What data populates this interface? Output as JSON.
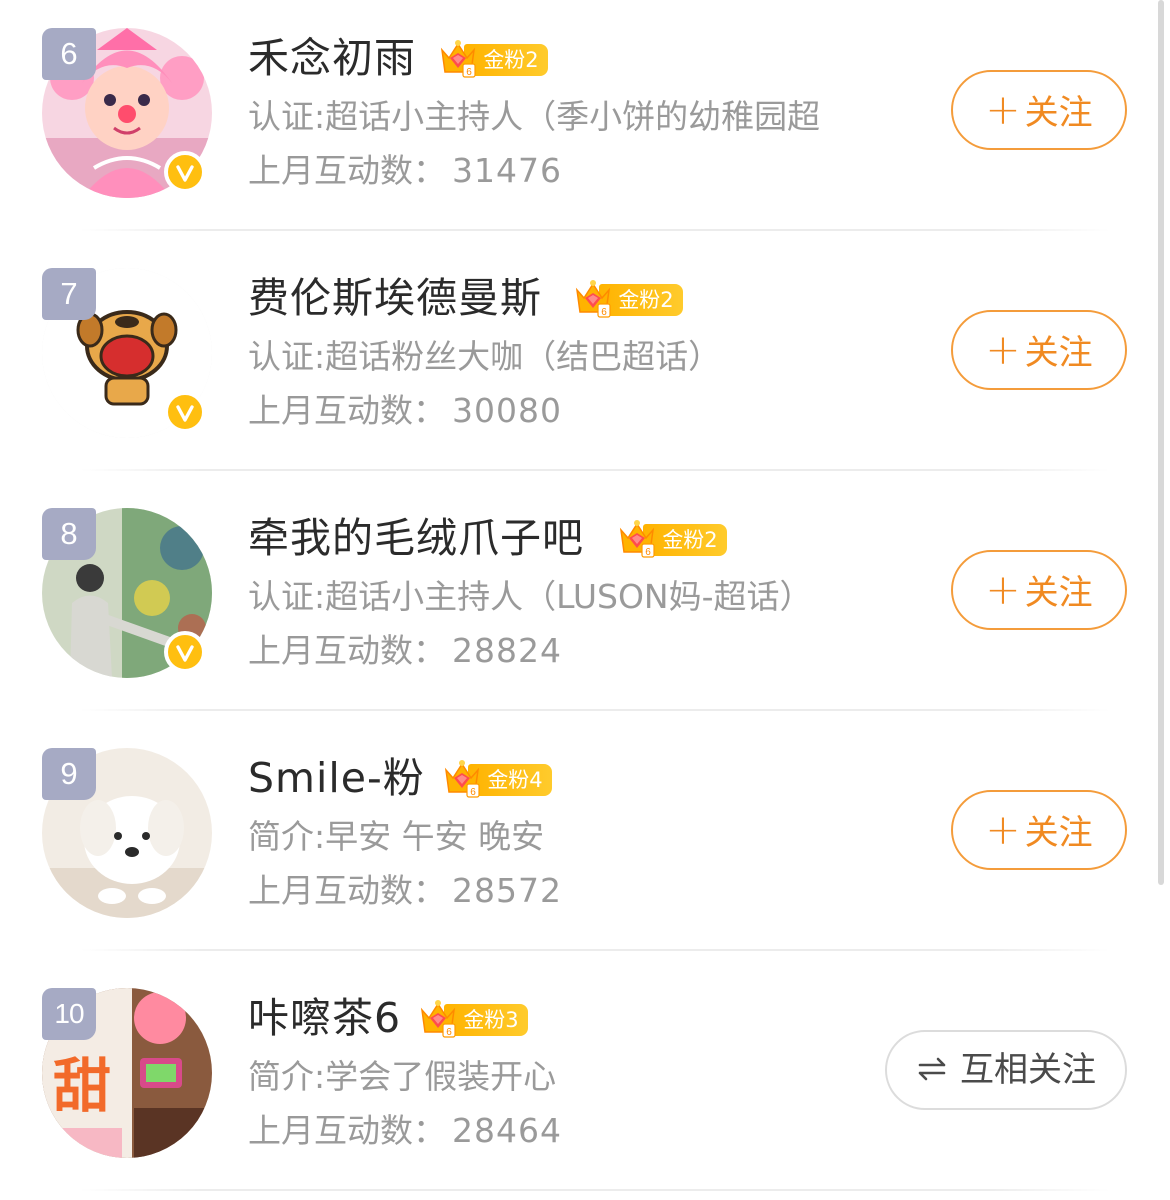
{
  "list": [
    {
      "rank": "6",
      "name": "禾念初雨",
      "fan_badge": "金粉2",
      "description": "认证:超话小主持人（季小饼的幼稚园超",
      "stat_label": "上月互动数：",
      "stat_value": "31476",
      "verified": true,
      "action": "关注",
      "action_icon": "plus-icon"
    },
    {
      "rank": "7",
      "name": "费伦斯埃德曼斯",
      "fan_badge": "金粉2",
      "description": "认证:超话粉丝大咖（结巴超话）",
      "stat_label": "上月互动数：",
      "stat_value": "30080",
      "verified": true,
      "action": "关注",
      "action_icon": "plus-icon"
    },
    {
      "rank": "8",
      "name": "牵我的毛绒爪子吧",
      "fan_badge": "金粉2",
      "description": "认证:超话小主持人（LUSON妈-超话）",
      "stat_label": "上月互动数：",
      "stat_value": "28824",
      "verified": true,
      "action": "关注",
      "action_icon": "plus-icon"
    },
    {
      "rank": "9",
      "name": "Smile-粉",
      "fan_badge": "金粉4",
      "description": "简介:早安 午安 晚安",
      "stat_label": "上月互动数：",
      "stat_value": "28572",
      "verified": false,
      "action": "关注",
      "action_icon": "plus-icon"
    },
    {
      "rank": "10",
      "name": "咔嚓茶6",
      "fan_badge": "金粉3",
      "description": "简介:学会了假装开心",
      "stat_label": "上月互动数：",
      "stat_value": "28464",
      "verified": false,
      "action": "互相关注",
      "action_icon": "swap-arrows-icon"
    }
  ],
  "colors": {
    "accent": "#f08a22",
    "rank_badge": "#a6aac4",
    "verified": "#ffbf10",
    "fan_badge": "#ffb300",
    "secondary_text": "#9a9a9a"
  }
}
